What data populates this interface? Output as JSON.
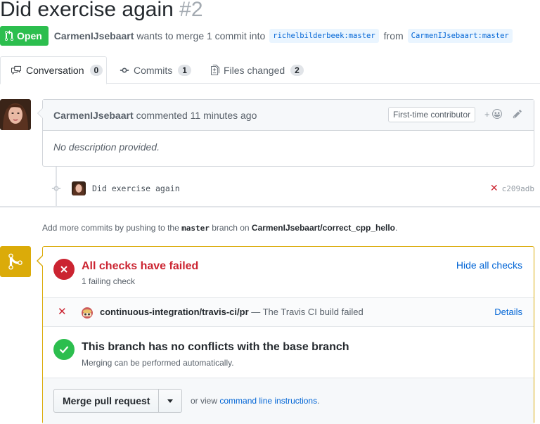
{
  "pr": {
    "title": "Did exercise again",
    "number": "#2",
    "state": "Open",
    "author": "CarmenIJsebaart",
    "merge_text": "wants to merge 1 commit into",
    "base_ref": "richelbilderbeek:master",
    "from_text": "from",
    "head_ref": "CarmenIJsebaart:master"
  },
  "tabs": [
    {
      "label": "Conversation",
      "count": "0",
      "icon": "comment-discussion-icon"
    },
    {
      "label": "Commits",
      "count": "1",
      "icon": "git-commit-icon"
    },
    {
      "label": "Files changed",
      "count": "2",
      "icon": "diff-icon"
    }
  ],
  "comment": {
    "author": "CarmenIJsebaart",
    "action": "commented 11 minutes ago",
    "badge": "First-time contributor",
    "reaction_label": "+",
    "body": "No description provided."
  },
  "commit": {
    "message": "Did exercise again",
    "status_icon": "✕",
    "sha": "c209adb"
  },
  "hint": {
    "prefix": "Add more commits by pushing to the",
    "branch": "master",
    "middle": "branch on",
    "repo": "CarmenIJsebaart/correct_cpp_hello",
    "suffix": "."
  },
  "checks": {
    "title": "All checks have failed",
    "subtitle": "1 failing check",
    "hide_label": "Hide all checks",
    "items": [
      {
        "status_icon": "✕",
        "name": "continuous-integration/travis-ci/pr",
        "description": " — The Travis CI build failed",
        "details_label": "Details"
      }
    ]
  },
  "conflicts": {
    "title": "This branch has no conflicts with the base branch",
    "subtitle": "Merging can be performed automatically."
  },
  "merge": {
    "button_label": "Merge pull request",
    "or_view": "or view",
    "cli_link": "command line instructions",
    "period": "."
  },
  "colors": {
    "open_green": "#2cbe4e",
    "fail_red": "#cb2431",
    "warning_yellow": "#dbab09",
    "link_blue": "#0366d6"
  }
}
